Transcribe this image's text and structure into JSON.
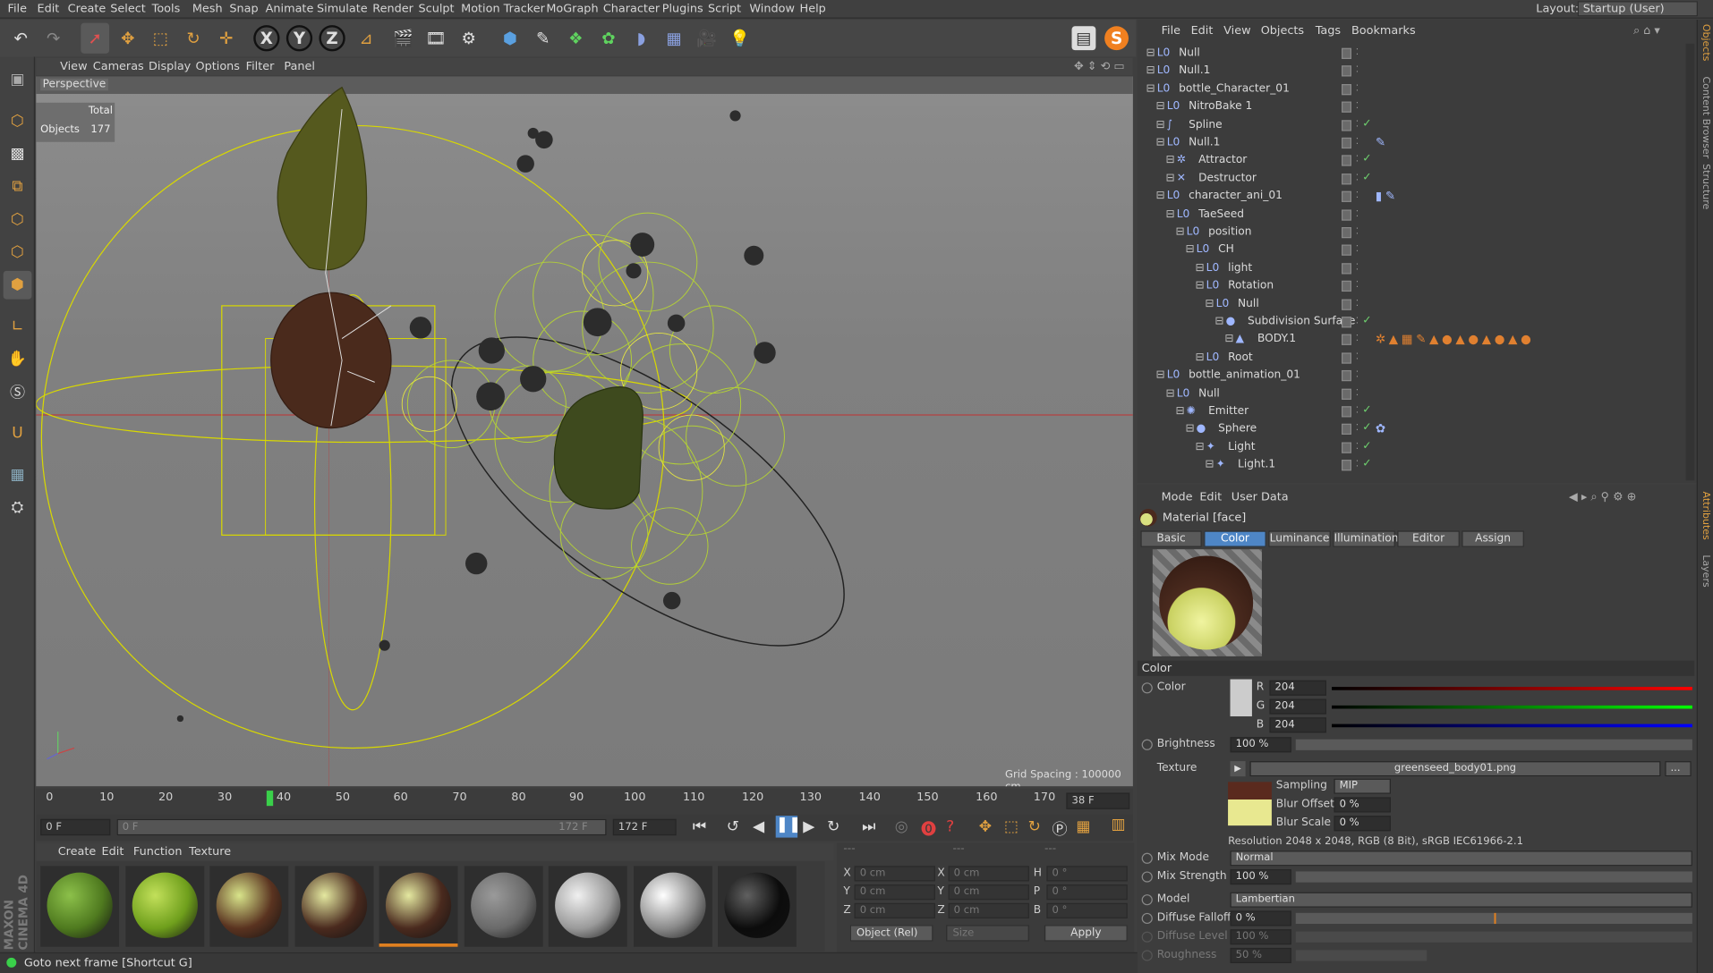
{
  "menu": [
    "File",
    "Edit",
    "Create",
    "Select",
    "Tools",
    "Mesh",
    "Snap",
    "Animate",
    "Simulate",
    "Render",
    "Sculpt",
    "Motion Tracker",
    "MoGraph",
    "Character",
    "Plugins",
    "Script",
    "Window",
    "Help"
  ],
  "layout": {
    "label": "Layout:",
    "value": "Startup (User)"
  },
  "viewport": {
    "menu": [
      "View",
      "Cameras",
      "Display",
      "Options",
      "Filter",
      "Panel"
    ],
    "name": "Perspective",
    "stats_header": "Total",
    "stats_label": "Objects",
    "stats_value": "177",
    "grid_spacing": "Grid Spacing : 100000 cm"
  },
  "timeline": {
    "ticks": [
      "0",
      "10",
      "20",
      "30",
      "40",
      "50",
      "60",
      "70",
      "80",
      "90",
      "100",
      "110",
      "120",
      "130",
      "140",
      "150",
      "160",
      "170"
    ],
    "current": "38 F",
    "start": "0 F",
    "range_start": "0 F",
    "range_end": "172 F",
    "end": "172 F"
  },
  "material_manager": {
    "menu": [
      "Create",
      "Edit",
      "Function",
      "Texture"
    ],
    "materials": [
      {
        "color": "#4f7a1f",
        "hi": "#8cc04a"
      },
      {
        "color": "#6f9f1c",
        "hi": "#c2e05a"
      },
      {
        "color": "#5a3320",
        "hi": "#d8e48a"
      },
      {
        "color": "#4a2a1e",
        "hi": "#e4e8a0"
      },
      {
        "color": "#4a2a1e",
        "hi": "#e4e8a0"
      },
      {
        "color": "#6a6a6a",
        "hi": "#9a9a9a"
      },
      {
        "color": "#9a9a9a",
        "hi": "#f0f0f0"
      },
      {
        "color": "#8a8a8a",
        "hi": "#ffffff"
      },
      {
        "color": "#0c0c0c",
        "hi": "#606060"
      }
    ]
  },
  "coordinates": {
    "rows": [
      {
        "a": "X",
        "av": "0 cm",
        "b": "X",
        "bv": "0 cm",
        "c": "H",
        "cv": "0 °"
      },
      {
        "a": "Y",
        "av": "0 cm",
        "b": "Y",
        "bv": "0 cm",
        "c": "P",
        "cv": "0 °"
      },
      {
        "a": "Z",
        "av": "0 cm",
        "b": "Z",
        "bv": "0 cm",
        "c": "B",
        "cv": "0 °"
      }
    ],
    "mode": "Object (Rel)",
    "size": "Size",
    "apply": "Apply"
  },
  "status": "Goto next frame [Shortcut G]",
  "object_manager": {
    "menu": [
      "File",
      "Edit",
      "View",
      "Objects",
      "Tags",
      "Bookmarks"
    ],
    "items": [
      {
        "name": "Null",
        "indent": 0,
        "icon": "L0",
        "check": false,
        "tags": ""
      },
      {
        "name": "Null.1",
        "indent": 0,
        "icon": "L0",
        "check": false,
        "tags": ""
      },
      {
        "name": "bottle_Character_01",
        "indent": 0,
        "icon": "L0",
        "check": false,
        "tags": ""
      },
      {
        "name": "NitroBake 1",
        "indent": 1,
        "icon": "L0",
        "check": false,
        "tags": ""
      },
      {
        "name": "Spline",
        "indent": 1,
        "icon": "∫",
        "check": true,
        "tags": ""
      },
      {
        "name": "Null.1",
        "indent": 1,
        "icon": "L0",
        "check": false,
        "tags": "✎"
      },
      {
        "name": "Attractor",
        "indent": 2,
        "icon": "✲",
        "check": true,
        "tags": ""
      },
      {
        "name": "Destructor",
        "indent": 2,
        "icon": "✕",
        "check": true,
        "tags": ""
      },
      {
        "name": "character_ani_01",
        "indent": 1,
        "icon": "L0",
        "check": false,
        "tags": "▮✎"
      },
      {
        "name": "TaeSeed",
        "indent": 2,
        "icon": "L0",
        "check": false,
        "tags": ""
      },
      {
        "name": "position",
        "indent": 3,
        "icon": "L0",
        "check": false,
        "tags": ""
      },
      {
        "name": "CH",
        "indent": 4,
        "icon": "L0",
        "check": false,
        "tags": ""
      },
      {
        "name": "light",
        "indent": 5,
        "icon": "L0",
        "check": false,
        "tags": ""
      },
      {
        "name": "Rotation",
        "indent": 5,
        "icon": "L0",
        "check": false,
        "tags": ""
      },
      {
        "name": "Null",
        "indent": 6,
        "icon": "L0",
        "check": false,
        "tags": ""
      },
      {
        "name": "Subdivision Surface",
        "indent": 7,
        "icon": "●",
        "check": true,
        "tags": ""
      },
      {
        "name": "BODY.1",
        "indent": 8,
        "icon": "▲",
        "check": false,
        "tags": "✲▲▦✎▲●▲●▲●▲●"
      },
      {
        "name": "Root",
        "indent": 5,
        "icon": "L0",
        "check": false,
        "tags": ""
      },
      {
        "name": "bottle_animation_01",
        "indent": 1,
        "icon": "L0",
        "check": false,
        "tags": ""
      },
      {
        "name": "Null",
        "indent": 2,
        "icon": "L0",
        "check": false,
        "tags": ""
      },
      {
        "name": "Emitter",
        "indent": 3,
        "icon": "✺",
        "check": true,
        "tags": ""
      },
      {
        "name": "Sphere",
        "indent": 4,
        "icon": "●",
        "check": true,
        "tags": "✿"
      },
      {
        "name": "Light",
        "indent": 5,
        "icon": "✦",
        "check": true,
        "tags": ""
      },
      {
        "name": "Light.1",
        "indent": 6,
        "icon": "✦",
        "check": true,
        "tags": ""
      }
    ]
  },
  "attributes": {
    "menu": [
      "Mode",
      "Edit",
      "User Data"
    ],
    "title": "Material [face]",
    "tabs": [
      "Basic",
      "Color",
      "Luminance",
      "Illumination",
      "Editor",
      "Assign"
    ],
    "active_tab": "Color",
    "section": "Color",
    "color_label": "Color",
    "r_label": "R",
    "r": "204",
    "g_label": "G",
    "g": "204",
    "b_label": "B",
    "b": "204",
    "brightness_label": "Brightness",
    "brightness": "100 %",
    "texture_label": "Texture",
    "texture_file": "greenseed_body01.png",
    "sampling_label": "Sampling",
    "sampling": "MIP",
    "blur_offset_label": "Blur Offset",
    "blur_offset": "0 %",
    "blur_scale_label": "Blur Scale",
    "blur_scale": "0 %",
    "resolution": "Resolution 2048 x 2048, RGB (8 Bit), sRGB IEC61966-2.1",
    "mix_mode_label": "Mix Mode",
    "mix_mode": "Normal",
    "mix_strength_label": "Mix Strength",
    "mix_strength": "100 %",
    "model_label": "Model",
    "model": "Lambertian",
    "diffuse_falloff_label": "Diffuse Falloff",
    "diffuse_falloff": "0 %",
    "diffuse_level_label": "Diffuse Level",
    "diffuse_level": "100 %",
    "roughness_label": "Roughness",
    "roughness": "50 %"
  },
  "side_tabs": [
    "Objects",
    "Content Browser",
    "Structure",
    "Attributes",
    "Layers"
  ],
  "maxon": "MAXON CINEMA 4D"
}
